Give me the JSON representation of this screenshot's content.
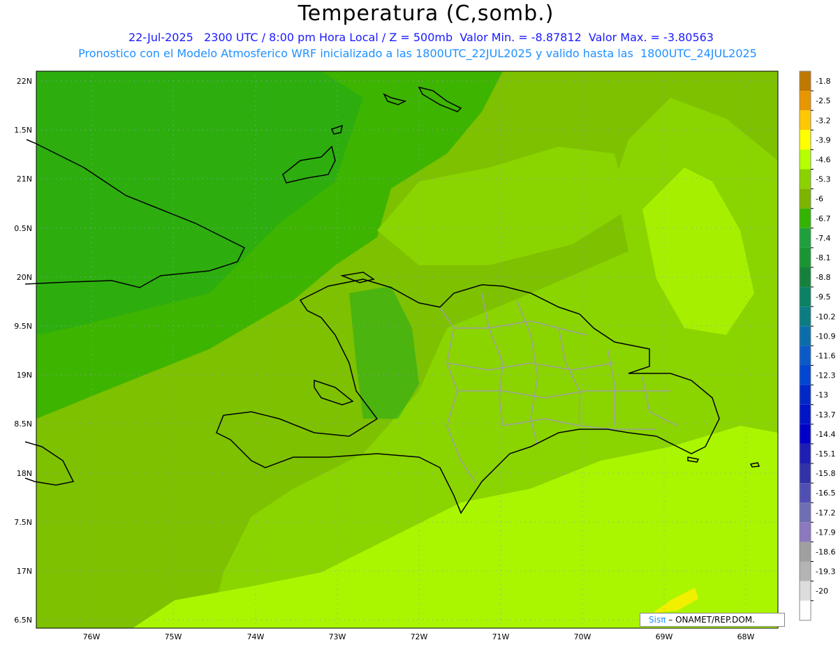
{
  "header": {
    "title": "Temperatura (C,somb.)",
    "subtitle_line1": "22-Jul-2025   2300 UTC / 8:00 pm Hora Local / Z = 500mb  Valor Min. = -8.87812  Valor Max. = -3.80563",
    "subtitle_line2": "Pronostico con el Modelo Atmosferico WRF inicializado a las 1800UTC_22JUL2025 y valido hasta las  1800UTC_24JUL2025"
  },
  "map": {
    "lat_labels": [
      "22N",
      "1.5N",
      "21N",
      "0.5N",
      "20N",
      "9.5N",
      "19N",
      "8.5N",
      "18N",
      "7.5N",
      "17N",
      "6.5N"
    ],
    "lon_labels": [
      "76W",
      "75W",
      "74W",
      "73W",
      "72W",
      "71W",
      "70W",
      "69W",
      "68W"
    ],
    "colors": {
      "c_minus6": "#7dc100",
      "c_minus6_7": "#3db400",
      "c_minus5_3": "#8ad400",
      "c_minus4_6": "#aaf500",
      "c_minus3_9": "#f0f000",
      "c_minus7_4": "#1aa71e",
      "coast": "#000000",
      "province_border": "#a0a0a0",
      "grid": "#9999cc"
    }
  },
  "colorbar": {
    "labels": [
      "-1.8",
      "-2.5",
      "-3.2",
      "-3.9",
      "-4.6",
      "-5.3",
      "-6",
      "-6.7",
      "-7.4",
      "-8.1",
      "-8.8",
      "-9.5",
      "-10.2",
      "-10.9",
      "-11.6",
      "-12.3",
      "-13",
      "-13.7",
      "-14.4",
      "-15.1",
      "-15.8",
      "-16.5",
      "-17.2",
      "-17.9",
      "-18.6",
      "-19.3",
      "-20"
    ],
    "colors": [
      "#c07800",
      "#e89600",
      "#ffc800",
      "#ffff00",
      "#b4ff00",
      "#8cd200",
      "#7db400",
      "#32b400",
      "#1ea03c",
      "#199632",
      "#14823c",
      "#0a8264",
      "#0a7d82",
      "#0a6eaa",
      "#0a5ac8",
      "#0046d2",
      "#0028c8",
      "#0014c8",
      "#0000c8",
      "#1e1eb4",
      "#3232aa",
      "#5050b4",
      "#6e6eb4",
      "#8c78be",
      "#a0a0a0",
      "#b4b4b4",
      "#dcdcdc",
      "#ffffff"
    ]
  },
  "credit": {
    "brand": "Sisπ",
    "org": "– ONAMET/REP.DOM."
  }
}
